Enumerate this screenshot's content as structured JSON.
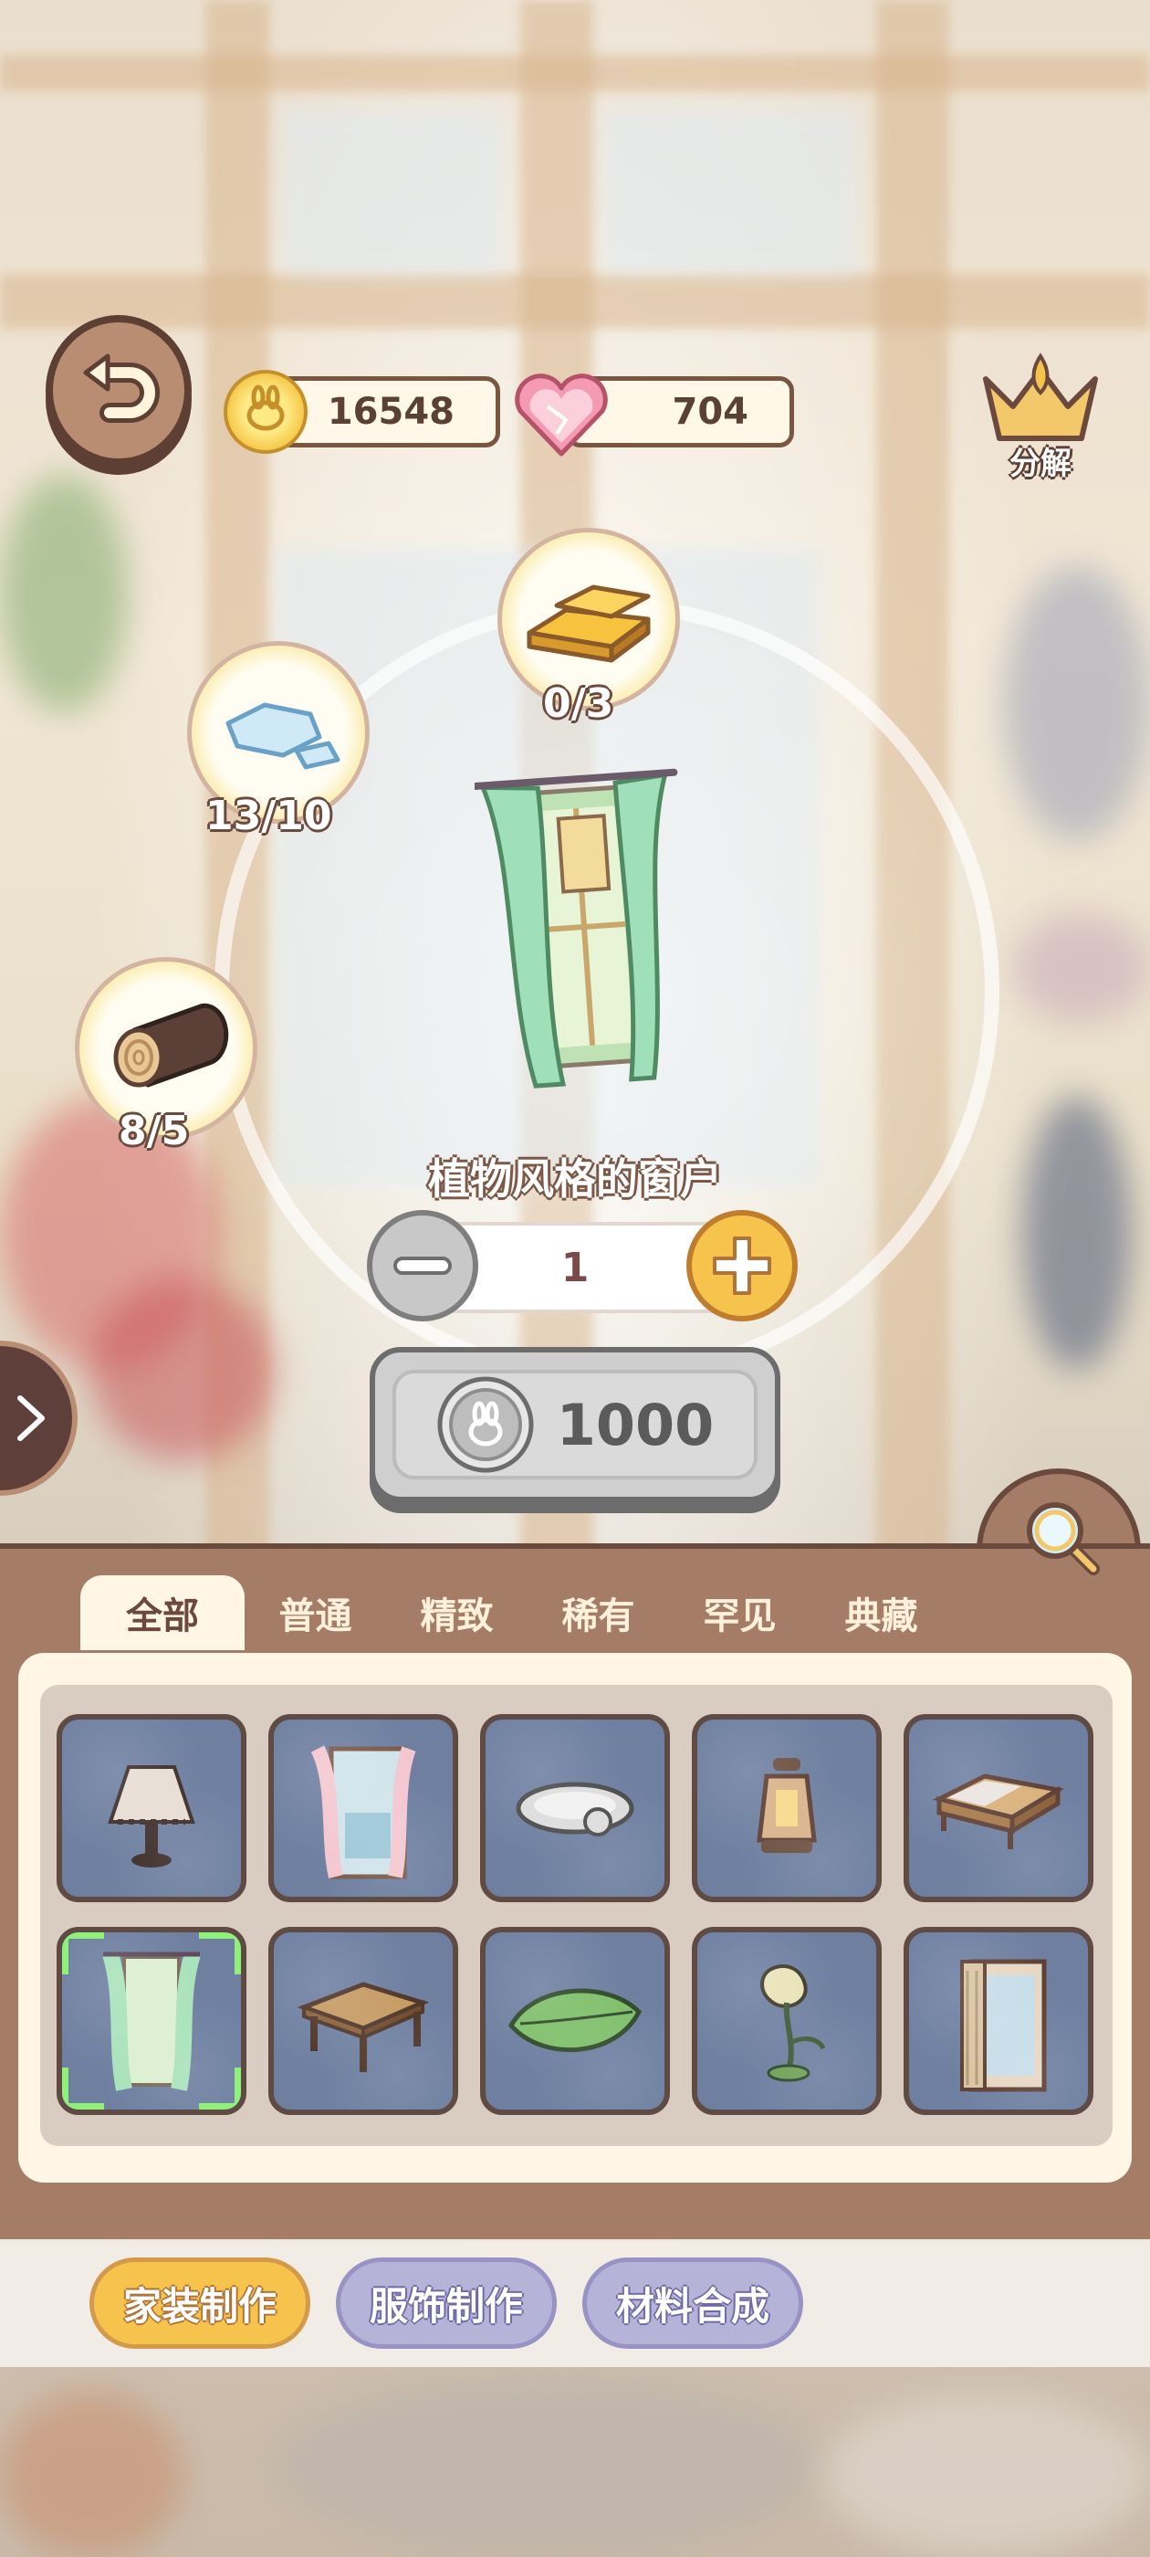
{
  "currency": {
    "coins": "16548",
    "hearts": "704"
  },
  "decompose": {
    "label": "分解"
  },
  "materials": [
    {
      "name": "gold-bar",
      "count": "0/3"
    },
    {
      "name": "ice-crystal",
      "count": "13/10"
    },
    {
      "name": "wood-log",
      "count": "8/5"
    }
  ],
  "item": {
    "name": "植物风格的窗户"
  },
  "quantity": {
    "value": "1"
  },
  "craft": {
    "price": "1000"
  },
  "tabs": [
    {
      "label": "全部",
      "active": true
    },
    {
      "label": "普通"
    },
    {
      "label": "精致"
    },
    {
      "label": "稀有"
    },
    {
      "label": "罕见"
    },
    {
      "label": "典藏"
    }
  ],
  "grid": [
    "lamp-icon",
    "window-icon",
    "tray-icon",
    "lantern-icon",
    "bed-icon",
    "curtain-window-icon",
    "table-icon",
    "leaf-rug-icon",
    "flower-lamp-icon",
    "blind-window-icon"
  ],
  "categories": [
    {
      "label": "家装制作",
      "active": true
    },
    {
      "label": "服饰制作"
    },
    {
      "label": "材料合成"
    }
  ],
  "colors": {
    "panel": "#a57d67",
    "accent": "#f6c34c",
    "selection": "#8ff07a"
  }
}
